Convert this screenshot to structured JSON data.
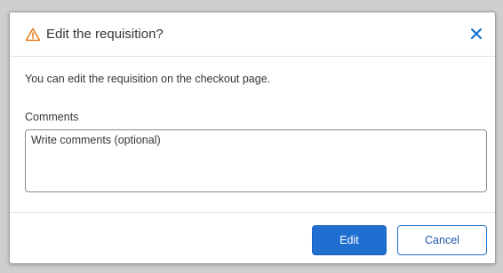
{
  "dialog": {
    "title": "Edit the requisition?",
    "title_icon": "warning-triangle-icon",
    "close_icon": "close-icon",
    "message": "You can edit the requisition on the checkout page.",
    "comments": {
      "label": "Comments",
      "value": "",
      "placeholder": "Write comments (optional)"
    },
    "buttons": {
      "edit_label": "Edit",
      "cancel_label": "Cancel"
    }
  },
  "colors": {
    "warning": "#e9730c",
    "close": "#0a6ed1",
    "primary": "#1f6fd0"
  }
}
